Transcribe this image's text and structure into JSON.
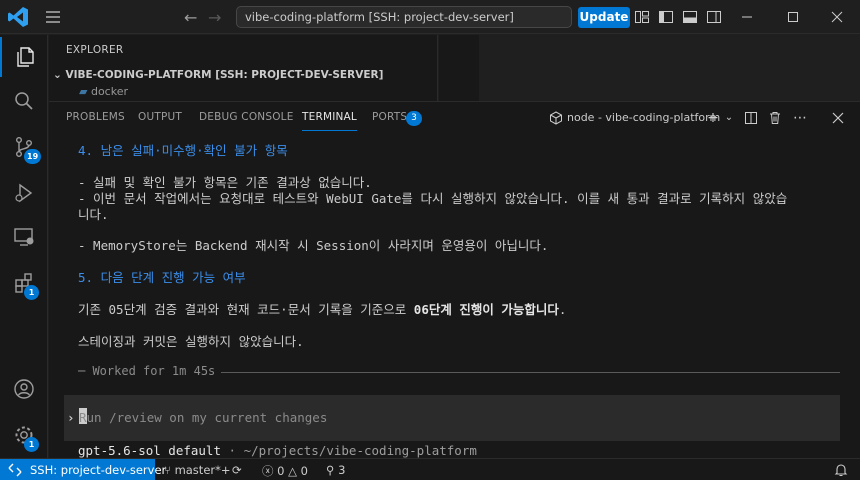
{
  "titlebar": {
    "search_value": "vibe-coding-platform [SSH: project-dev-server]",
    "update_label": "Update"
  },
  "activity": {
    "source_control_badge": "19",
    "extensions_badge": "1",
    "settings_badge": "1"
  },
  "explorer": {
    "title": "EXPLORER",
    "folder": "VIBE-CODING-PLATFORM [SSH: PROJECT-DEV-SERVER]",
    "item": "docker"
  },
  "panel": {
    "tabs": [
      {
        "label": "PROBLEMS"
      },
      {
        "label": "OUTPUT"
      },
      {
        "label": "DEBUG CONSOLE"
      },
      {
        "label": "TERMINAL"
      },
      {
        "label": "PORTS"
      }
    ],
    "ports_badge": "3",
    "terminal_name": "node - vibe-coding-platform"
  },
  "terminal": {
    "l1": "4. 남은 실패·미수행·확인 불가 항목",
    "l2": "- 실패 및 확인 불가 항목은 기존 결과상 없습니다.",
    "l3": "- 이번 문서 작업에서는 요청대로 테스트와 WebUI Gate를 다시 실행하지 않았습니다. 이를 새 통과 결과로 기록하지 않았습",
    "l3b": "  니다.",
    "l4": "- MemoryStore는 Backend 재시작 시 Session이 사라지며 운영용이 아닙니다.",
    "l5": "5. 다음 단계 진행 가능 여부",
    "l6a": "기존 05단계 검증 결과와 현재 코드·문서 기록을 기준으로 ",
    "l6b": "06단계 진행이 가능합니다",
    "l6c": ".",
    "l7": "스테이징과 커밋은 실행하지 않았습니다.",
    "worked": "─ Worked for 1m 45s",
    "prompt_caret": "›",
    "prompt_placeholder": "Run /review on my current changes",
    "model": "gpt-5.6-sol default",
    "path": " · ~/projects/vibe-coding-platform"
  },
  "statusbar": {
    "remote": "SSH: project-dev-server",
    "branch": "master*+",
    "errors": "0",
    "warnings": "0",
    "ports": "3"
  }
}
